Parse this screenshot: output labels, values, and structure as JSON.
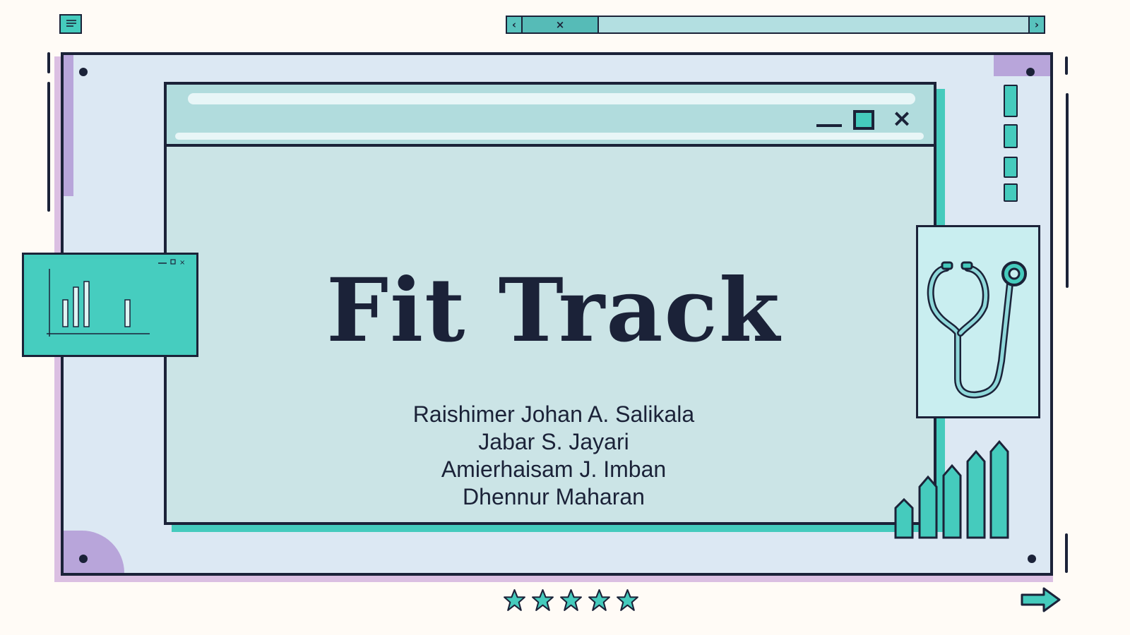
{
  "scrollbar": {
    "left_arrow": "‹",
    "right_arrow": "›",
    "thumb_label": "×"
  },
  "window": {
    "min_label": "",
    "close_label": "×"
  },
  "slide": {
    "title": "Fit Track",
    "authors": [
      "Raishimer Johan A. Salikala",
      "Jabar S. Jayari",
      "Amierhaisam J. Imban",
      "Dhennur Maharan"
    ]
  },
  "icons": {
    "menu": "menu-icon",
    "chart": "bar-chart-icon",
    "stethoscope": "stethoscope-icon",
    "stars": "star-icon",
    "next": "arrow-right-icon"
  },
  "rating": {
    "stars": 5,
    "max": 5
  },
  "colors": {
    "background": "#fffbf6",
    "ink": "#1b2238",
    "teal": "#45cbbd",
    "pale_teal": "#cbe4e6",
    "frame": "#dce8f3",
    "lilac": "#b8a5da"
  }
}
